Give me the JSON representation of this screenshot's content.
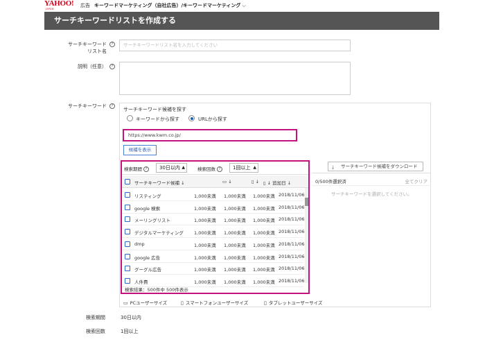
{
  "header": {
    "logo": "YAHOO!",
    "logo_sub": "JAPAN",
    "logo_ad": "広告",
    "account": "キーワードマーケティング（自社広告）/キーワードマーケティング"
  },
  "page": {
    "title": "サーチキーワードリストを作成する"
  },
  "form": {
    "list_name_label_1": "サーチキーワード",
    "list_name_label_2": "リスト名",
    "list_name_placeholder": "サーチキーワードリスト名を入力してください",
    "description_label": "説明（任意）",
    "keyword_label": "サーチキーワード"
  },
  "finder": {
    "title": "サーチキーワード候補を探す",
    "opt_keyword": "キーワードから探す",
    "opt_url": "URLから探す",
    "url_value": "https://www.kwm.co.jp/",
    "show_button": "候補を表示"
  },
  "results": {
    "period_label": "検索期間",
    "period_value": "30日以内",
    "count_label": "検索回数",
    "count_value": "1回以上",
    "col_keyword": "サーチキーワード候補",
    "col_added": "追加日",
    "rows": [
      {
        "keyword": "リスティング",
        "pc": "1,000未満",
        "sp": "1,000未満",
        "tab": "1,000未満",
        "date": "2018/11/06"
      },
      {
        "keyword": "google 検索",
        "pc": "1,000未満",
        "sp": "1,000未満",
        "tab": "1,000未満",
        "date": "2018/11/06"
      },
      {
        "keyword": "メーリングリスト",
        "pc": "1,000未満",
        "sp": "1,000未満",
        "tab": "1,000未満",
        "date": "2018/11/06"
      },
      {
        "keyword": "デジタルマーケティング",
        "pc": "1,000未満",
        "sp": "1,000未満",
        "tab": "1,000未満",
        "date": "2018/11/06"
      },
      {
        "keyword": "dmp",
        "pc": "1,000未満",
        "sp": "1,000未満",
        "tab": "1,000未満",
        "date": "2018/11/06"
      },
      {
        "keyword": "google 広告",
        "pc": "1,000未満",
        "sp": "1,000未満",
        "tab": "1,000未満",
        "date": "2018/11/06"
      },
      {
        "keyword": "グーグル広告",
        "pc": "1,000未満",
        "sp": "1,000未満",
        "tab": "1,000未満",
        "date": "2018/11/06"
      },
      {
        "keyword": "人件費",
        "pc": "1,000未満",
        "sp": "1,000未満",
        "tab": "1,000未満",
        "date": "2018/11/06"
      }
    ],
    "footer": "検索結果：500件中 500件表示"
  },
  "selected": {
    "download_button": "サーチキーワード候補をダウンロード",
    "count": "0/500件選択済",
    "clear_all": "全てクリア",
    "empty_message": "サーチキーワードを選択してください。"
  },
  "devices": {
    "pc": "PCユーザーサイズ",
    "sp": "スマートフォンユーザーサイズ",
    "tab": "タブレットユーザーサイズ"
  },
  "summary": {
    "period_label": "検索期間",
    "period_value": "30日以内",
    "count_label": "検索回数",
    "count_value": "1回以上"
  },
  "colors": {
    "accent": "#c2127b",
    "title_bg": "#555555",
    "link": "#2a5db0"
  }
}
